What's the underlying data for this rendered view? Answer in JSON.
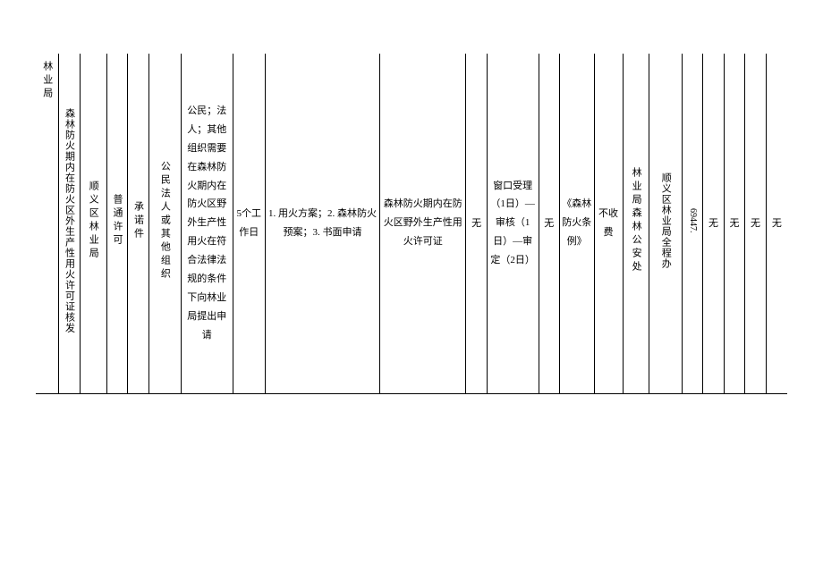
{
  "row": {
    "c1": "林业局",
    "c2": "森林防火期内在防火区外生产性用火许可证核发",
    "c3": "顺义区林业局",
    "c4": "普通许可",
    "c5": "承诺件",
    "c6": "公民法人或其他组织",
    "c7": "公民；法人；其他组织需要在森林防火期内在防火区野外生产性用火在符合法律法规的条件下向林业局提出申请",
    "c8": "5个工作日",
    "c9": "1. 用火方案；2. 森林防火预案；3. 书面申请",
    "c10": "森林防火期内在防火区野外生产性用火许可证",
    "c11": "无",
    "c12": "窗口受理（1日）—审核（1日）—审定（2日）",
    "c13": "无",
    "c14": "《森林防火条例》",
    "c15": "不收费",
    "c16": "林业局森林公安处",
    "c17": "顺义区林业局全程办",
    "c18": "69447.",
    "c19": "无",
    "c20": "无",
    "c21": "无",
    "c22": "无"
  }
}
